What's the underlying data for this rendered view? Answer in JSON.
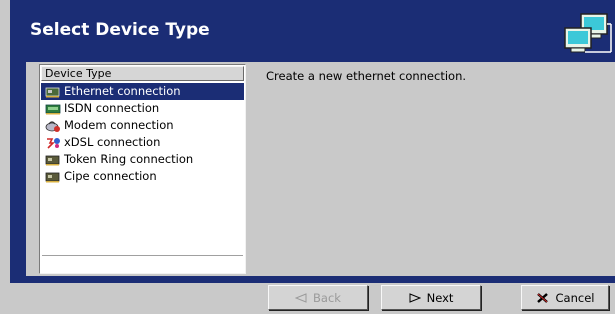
{
  "header": {
    "title": "Select Device Type",
    "logo_icon": "network-computers-icon"
  },
  "list": {
    "header": "Device Type",
    "selected_color": "#1b2d75",
    "items": [
      {
        "label": "Ethernet connection",
        "icon": "ethernet-card-icon",
        "selected": true
      },
      {
        "label": "ISDN connection",
        "icon": "isdn-card-icon",
        "selected": false
      },
      {
        "label": "Modem connection",
        "icon": "modem-icon",
        "selected": false
      },
      {
        "label": "xDSL connection",
        "icon": "xdsl-icon",
        "selected": false
      },
      {
        "label": "Token Ring connection",
        "icon": "token-ring-card-icon",
        "selected": false
      },
      {
        "label": "Cipe connection",
        "icon": "cipe-card-icon",
        "selected": false
      }
    ]
  },
  "description": "Create a new ethernet connection.",
  "buttons": {
    "back": {
      "label": "Back",
      "icon": "back-arrow-icon",
      "enabled": false
    },
    "next": {
      "label": "Next",
      "icon": "next-arrow-icon",
      "enabled": true
    },
    "cancel": {
      "label": "Cancel",
      "icon": "cancel-x-icon",
      "enabled": true
    }
  },
  "colors": {
    "banner": "#1b2d75",
    "background": "#c9c9c9"
  }
}
